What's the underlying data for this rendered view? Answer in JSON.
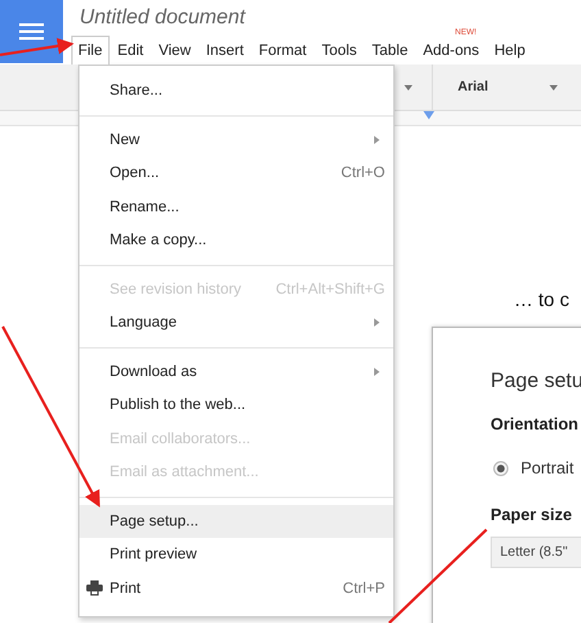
{
  "app": {
    "title": "Untitled document",
    "menu": [
      {
        "label": "File",
        "selected": true
      },
      {
        "label": "Edit",
        "selected": false
      },
      {
        "label": "View",
        "selected": false
      },
      {
        "label": "Insert",
        "selected": false
      },
      {
        "label": "Format",
        "selected": false
      },
      {
        "label": "Tools",
        "selected": false
      },
      {
        "label": "Table",
        "selected": false
      },
      {
        "label": "Add-ons",
        "selected": false,
        "badge": "NEW!"
      },
      {
        "label": "Help",
        "selected": false
      }
    ]
  },
  "toolbar": {
    "font": "Arial"
  },
  "file_menu": {
    "items": [
      {
        "kind": "item",
        "label": "Share...",
        "disabled": false,
        "selected": false
      },
      {
        "kind": "separator"
      },
      {
        "kind": "item",
        "label": "New",
        "disabled": false,
        "selected": false,
        "submenu": true
      },
      {
        "kind": "item",
        "label": "Open...",
        "shortcut": "Ctrl+O",
        "disabled": false,
        "selected": false
      },
      {
        "kind": "item",
        "label": "Rename...",
        "disabled": false,
        "selected": false
      },
      {
        "kind": "item",
        "label": "Make a copy...",
        "disabled": false,
        "selected": false
      },
      {
        "kind": "separator"
      },
      {
        "kind": "item",
        "label": "See revision history",
        "shortcut": "Ctrl+Alt+Shift+G",
        "disabled": true,
        "selected": false
      },
      {
        "kind": "item",
        "label": "Language",
        "disabled": false,
        "selected": false,
        "submenu": true
      },
      {
        "kind": "separator"
      },
      {
        "kind": "item",
        "label": "Download as",
        "disabled": false,
        "selected": false,
        "submenu": true
      },
      {
        "kind": "item",
        "label": "Publish to the web...",
        "disabled": false,
        "selected": false
      },
      {
        "kind": "item",
        "label": "Email collaborators...",
        "disabled": true,
        "selected": false
      },
      {
        "kind": "item",
        "label": "Email as attachment...",
        "disabled": true,
        "selected": false
      },
      {
        "kind": "separator"
      },
      {
        "kind": "item",
        "label": "Page setup...",
        "disabled": false,
        "selected": true
      },
      {
        "kind": "item",
        "label": "Print preview",
        "disabled": false,
        "selected": false
      },
      {
        "kind": "item",
        "label": "Print",
        "shortcut": "Ctrl+P",
        "disabled": false,
        "selected": false,
        "has_icon": true
      }
    ]
  },
  "caption": "… to c",
  "page_setup": {
    "title": "Page setu",
    "orientation_label": "Orientation",
    "orientation": [
      {
        "label": "Portrait",
        "selected": true
      }
    ],
    "paper_size_label": "Paper size",
    "paper_size": "Letter (8.5\""
  }
}
